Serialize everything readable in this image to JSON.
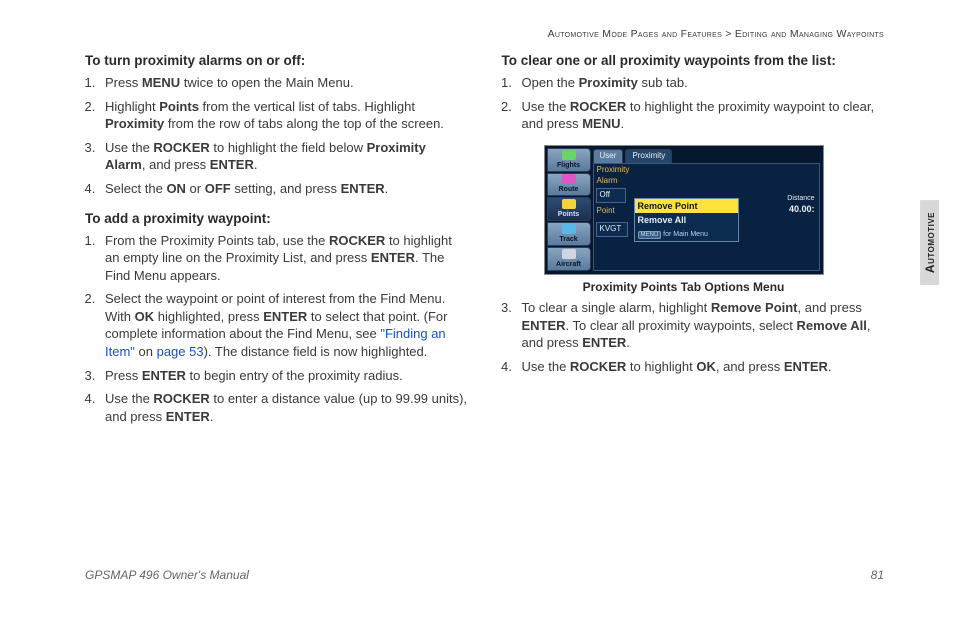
{
  "breadcrumb": {
    "left": "Automotive Mode Pages and Features",
    "sep": " > ",
    "right": "Editing and Managing Waypoints"
  },
  "sideTab": "Automotive",
  "footer": {
    "left": "GPSMAP 496 Owner's Manual",
    "right": "81"
  },
  "col1": {
    "h1": "To turn proximity alarms on or off:",
    "l1": [
      [
        [
          "Press "
        ],
        [
          "b",
          "MENU"
        ],
        [
          " twice to open the Main Menu."
        ]
      ],
      [
        [
          "Highlight "
        ],
        [
          "b",
          "Points"
        ],
        [
          " from the vertical list of tabs. Highlight "
        ],
        [
          "b",
          "Proximity"
        ],
        [
          " from the row of tabs along the top of the screen."
        ]
      ],
      [
        [
          "Use the "
        ],
        [
          "b",
          "ROCKER"
        ],
        [
          " to highlight the field below "
        ],
        [
          "b",
          "Proximity Alarm"
        ],
        [
          ", and press "
        ],
        [
          "b",
          "ENTER"
        ],
        [
          "."
        ]
      ],
      [
        [
          "Select the "
        ],
        [
          "b",
          "ON"
        ],
        [
          " or "
        ],
        [
          "b",
          "OFF"
        ],
        [
          " setting, and press "
        ],
        [
          "b",
          "ENTER"
        ],
        [
          "."
        ]
      ]
    ],
    "h2": "To add a proximity waypoint:",
    "l2": [
      [
        [
          "From the Proximity Points tab, use the "
        ],
        [
          "b",
          "ROCKER"
        ],
        [
          " to highlight an empty line on the Proximity List, and press "
        ],
        [
          "b",
          "ENTER"
        ],
        [
          ". The Find Menu appears."
        ]
      ],
      [
        [
          "Select the waypoint or point of interest from the Find Menu. With "
        ],
        [
          "b",
          "OK"
        ],
        [
          " highlighted, press "
        ],
        [
          "b",
          "ENTER"
        ],
        [
          " to select that point. (For complete information about the Find Menu, see "
        ],
        [
          "link",
          "\"Finding an Item\""
        ],
        [
          " on "
        ],
        [
          "link",
          "page 53"
        ],
        [
          "). The distance field is now highlighted."
        ]
      ],
      [
        [
          "Press "
        ],
        [
          "b",
          "ENTER"
        ],
        [
          " to begin entry of the proximity radius."
        ]
      ],
      [
        [
          "Use the "
        ],
        [
          "b",
          "ROCKER"
        ],
        [
          " to enter a distance value (up to 99.99 units), and press "
        ],
        [
          "b",
          "ENTER"
        ],
        [
          "."
        ]
      ]
    ]
  },
  "col2": {
    "h1": "To clear one or all proximity waypoints from the list:",
    "l1": [
      [
        [
          "Open the "
        ],
        [
          "b",
          "Proximity"
        ],
        [
          " sub tab."
        ]
      ],
      [
        [
          "Use the "
        ],
        [
          "b",
          "ROCKER"
        ],
        [
          " to highlight the proximity waypoint to clear, and press "
        ],
        [
          "b",
          "MENU"
        ],
        [
          "."
        ]
      ]
    ],
    "caption": "Proximity Points Tab Options Menu",
    "l2": [
      [
        [
          "To clear a single alarm, highlight "
        ],
        [
          "b",
          "Remove Point"
        ],
        [
          ", and press "
        ],
        [
          "b",
          "ENTER"
        ],
        [
          ". To clear all proximity waypoints, select "
        ],
        [
          "b",
          "Remove All"
        ],
        [
          ", and press "
        ],
        [
          "b",
          "ENTER"
        ],
        [
          "."
        ]
      ],
      [
        [
          "Use the "
        ],
        [
          "b",
          "ROCKER"
        ],
        [
          " to highlight "
        ],
        [
          "b",
          "OK"
        ],
        [
          ", and press "
        ],
        [
          "b",
          "ENTER"
        ],
        [
          "."
        ]
      ]
    ]
  },
  "screenshot": {
    "sideTabs": [
      "Flights",
      "Route",
      "Points",
      "Track",
      "Aircraft"
    ],
    "activeIdx": 2,
    "topTabs": [
      "User",
      "Proximity"
    ],
    "alarmLabel": "Proximity Alarm",
    "alarmValue": "Off",
    "pointLabel": "Point",
    "pointValue": "KVGT",
    "distLabel": "Distance",
    "distValue": "40.00:",
    "menu": [
      "Remove Point",
      "Remove All"
    ],
    "menuFooter": "for Main Menu",
    "menuIcon": "MENU"
  }
}
